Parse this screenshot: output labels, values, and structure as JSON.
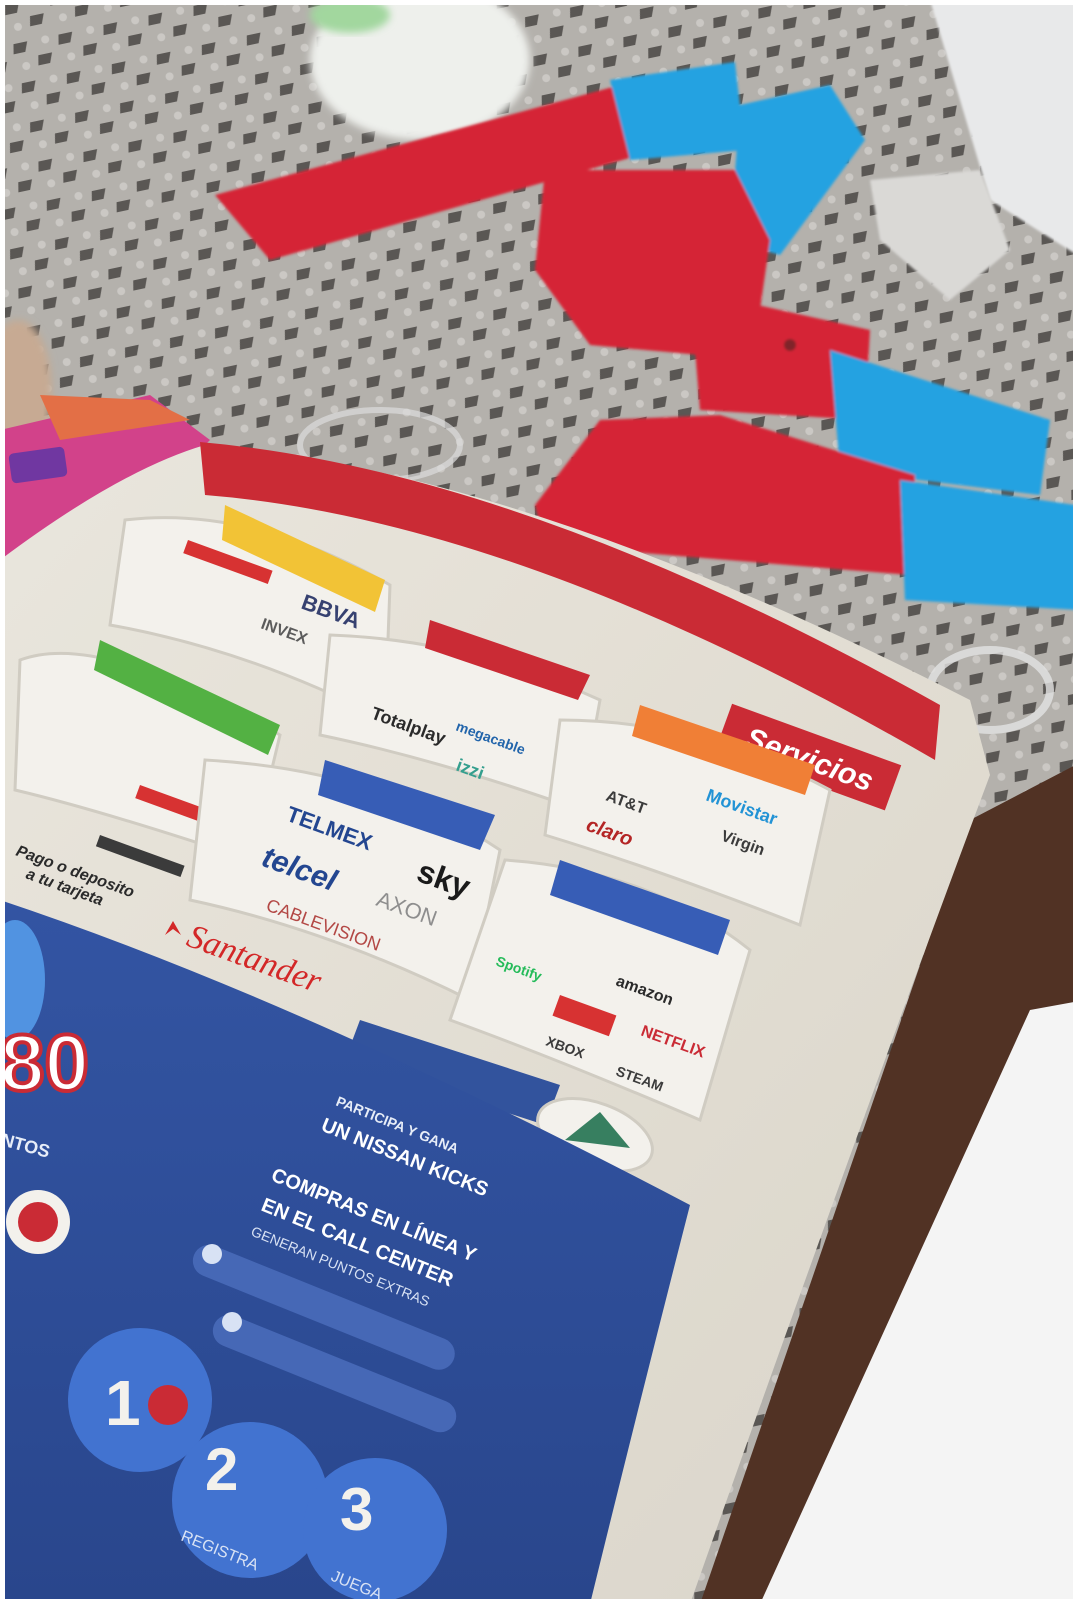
{
  "flyer": {
    "services_tag": "Servicios",
    "providers": {
      "telmex": "TELMEX",
      "telcel": "telcel",
      "sky": "sky",
      "axon": "AXON",
      "cablevision": "CABLEVISION",
      "bbva": "BBVA",
      "invex": "INVEX",
      "totalplay": "Totalplay",
      "megacable": "megacable",
      "izzi": "izzi",
      "att": "AT&T",
      "movistar": "Movistar",
      "claro": "claro",
      "virgin": "Virgin",
      "spotify": "Spotify",
      "amazon": "amazon",
      "netflix": "NETFLIX",
      "xbox": "XBOX",
      "steam": "STEAM"
    },
    "deposit_text_1": "Pago o deposito",
    "deposit_text_2": "a tu tarjeta",
    "santander": "Santander",
    "promo": {
      "participa": "PARTICIPA Y GANA",
      "nissan": "UN NISSAN KICKS",
      "compras_1": "COMPRAS EN LÍNEA Y",
      "compras_2": "EN EL CALL CENTER",
      "compras_3": "GENERAN PUNTOS EXTRAS",
      "big_number": "80",
      "side_text": "NTOS",
      "step_1": "1",
      "step_2": "2",
      "step_3": "3",
      "step_2_label": "REGISTRA",
      "step_3_label": "JUEGA"
    }
  },
  "colors": {
    "red": "#c8232d",
    "blue": "#1c3f8c",
    "toy_red": "#d41f2e",
    "toy_blue": "#1f9fe0"
  }
}
